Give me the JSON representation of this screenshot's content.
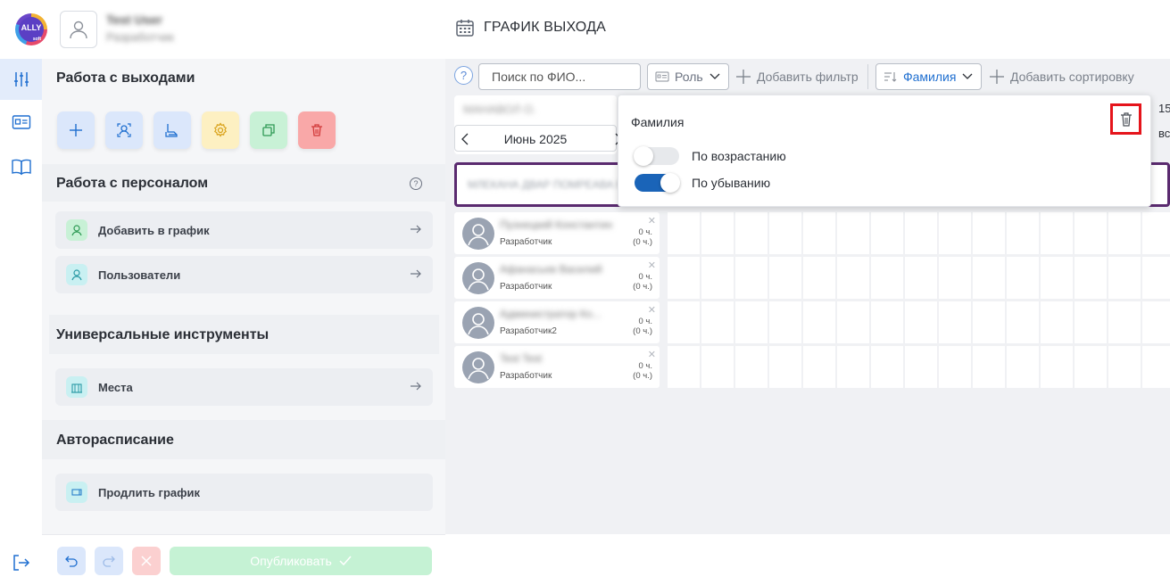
{
  "header": {
    "logo_text": "ALLY",
    "logo_sub": "soft",
    "user_name": "Test User",
    "user_role": "Разработчик",
    "page_title": "ГРАФИК ВЫХОДА"
  },
  "rail": {
    "icons": [
      "sliders-icon",
      "id-card-icon",
      "book-icon"
    ],
    "active_index": 0,
    "logout_icon": "logout-icon"
  },
  "panel": {
    "exits_title": "Работа с выходами",
    "tools": [
      {
        "icon": "plus-icon",
        "bg": "#dbe7fb"
      },
      {
        "icon": "user-search-icon",
        "bg": "#dbe7fb"
      },
      {
        "icon": "schedule-icon",
        "bg": "#dbe7fb"
      },
      {
        "icon": "gear-icon",
        "bg": "#fdf0c2"
      },
      {
        "icon": "copy-icon",
        "bg": "#c8f1d6"
      },
      {
        "icon": "trash-icon",
        "bg": "#f9a8a8"
      }
    ],
    "staff_title": "Работа с персоналом",
    "staff_items": [
      {
        "label": "Добавить в график",
        "icon": "user-add-icon"
      },
      {
        "label": "Пользователи",
        "icon": "users-icon"
      }
    ],
    "universal_title": "Универсальные инструменты",
    "universal_items": [
      {
        "label": "Места",
        "icon": "building-icon"
      }
    ],
    "auto_title": "Автораспиcание",
    "auto_items": [
      {
        "label": "Продлить график",
        "icon": "extend-icon"
      }
    ],
    "publish_label": "Опубликовать"
  },
  "toolbar": {
    "help": "?",
    "search_placeholder": "Поиск по ФИО...",
    "role_label": "Роль",
    "add_filter": "Добавить фильтр",
    "sort_label": "Фамилия",
    "add_sort": "Добавить сортировку"
  },
  "calendar": {
    "group_name": "МАНАВОЛ О.",
    "month": "Июнь 2025",
    "right_fragment_1": "15",
    "right_fragment_2": "вс",
    "group_bar_text": "МЛЕКАНА ДВАР ПОМРЕАВА МА"
  },
  "employees": [
    {
      "name": "Пузнецкий Константин",
      "role": "Разработчик",
      "hours": "0 ч.",
      "hours_sub": "(0 ч.)"
    },
    {
      "name": "Афанасьев Василий",
      "role": "Разработчик",
      "hours": "0 ч.",
      "hours_sub": "(0 ч.)"
    },
    {
      "name": "Администратор Ко...",
      "role": "Разработчик2",
      "hours": "0 ч.",
      "hours_sub": "(0 ч.)"
    },
    {
      "name": "Test Test",
      "role": "Разработчик",
      "hours": "0 ч.",
      "hours_sub": "(0 ч.)"
    }
  ],
  "sort_popover": {
    "title": "Фамилия",
    "asc_label": "По возрастанию",
    "asc_on": false,
    "desc_label": "По убыванию",
    "desc_on": true
  }
}
